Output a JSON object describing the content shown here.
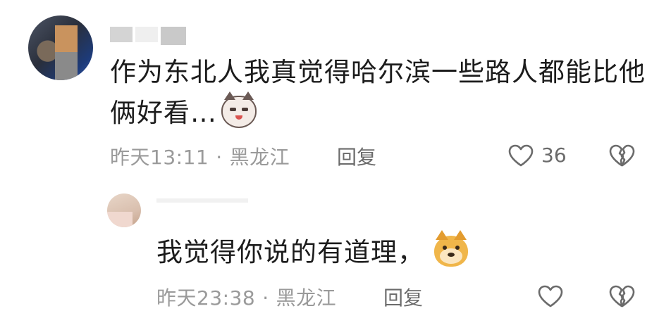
{
  "comments": [
    {
      "text": "作为东北人我真觉得哈尔滨一些路人都能比他俩好看…",
      "emoji": "cat-face-emoji",
      "time": "昨天13:11",
      "separator": "·",
      "location": "黑龙江",
      "reply_label": "回复",
      "likes": "36"
    },
    {
      "text": "我觉得你说的有道理，",
      "emoji": "doge-emoji",
      "time": "昨天23:38",
      "separator": "·",
      "location": "黑龙江",
      "reply_label": "回复"
    }
  ],
  "colors": {
    "text": "#1c1c1c",
    "meta": "#9a9a9a",
    "icon": "#6b6b6b"
  }
}
